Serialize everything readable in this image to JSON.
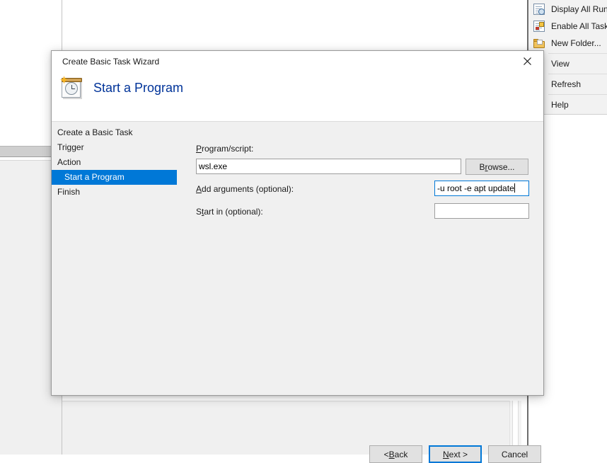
{
  "dialog": {
    "title": "Create Basic Task Wizard",
    "heading": "Start a Program",
    "icon": "wizard-calendar-clock-icon",
    "close_icon": "close-icon"
  },
  "wizard_nav": {
    "items": [
      {
        "label": "Create a Basic Task",
        "selected": false,
        "sub": false
      },
      {
        "label": "Trigger",
        "selected": false,
        "sub": false
      },
      {
        "label": "Action",
        "selected": false,
        "sub": false
      },
      {
        "label": "Start a Program",
        "selected": true,
        "sub": true
      },
      {
        "label": "Finish",
        "selected": false,
        "sub": false
      }
    ],
    "selected_color": "#0078d7"
  },
  "form": {
    "program_label_prefix": "",
    "program_label_accesskey": "P",
    "program_label_suffix": "rogram/script:",
    "program_value": "wsl.exe",
    "browse_prefix": "B",
    "browse_accesskey": "r",
    "browse_suffix": "owse...",
    "arguments_label_accesskey": "A",
    "arguments_label_suffix": "dd arguments (optional):",
    "arguments_value": "-u root -e apt update",
    "startin_label_prefix": "S",
    "startin_label_accesskey": "t",
    "startin_label_suffix": "art in (optional):",
    "startin_value": "",
    "focus_color": "#0078d7"
  },
  "buttons": {
    "back_prefix": "< ",
    "back_accesskey": "B",
    "back_suffix": "ack",
    "next_prefix": "",
    "next_accesskey": "N",
    "next_suffix": "ext >",
    "cancel_label": "Cancel"
  },
  "context_menu": {
    "items": [
      {
        "label": "Display All Run",
        "icon": "tasks-running-icon",
        "has_icon": true
      },
      {
        "label": "Enable All Tasks",
        "icon": "enable-tasks-icon",
        "has_icon": true
      },
      {
        "label": "New Folder...",
        "icon": "new-folder-icon",
        "has_icon": true
      },
      {
        "label": "View",
        "icon": "",
        "has_icon": false
      },
      {
        "label": "Refresh",
        "icon": "",
        "has_icon": false
      },
      {
        "label": "Help",
        "icon": "",
        "has_icon": false
      }
    ]
  }
}
